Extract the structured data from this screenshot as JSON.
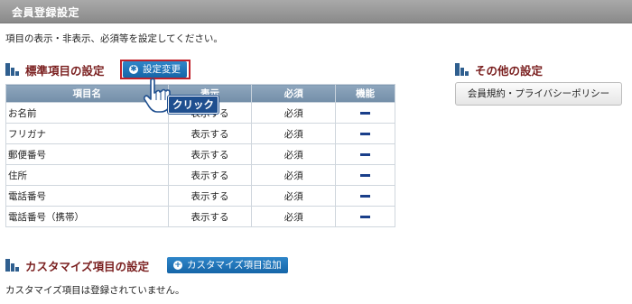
{
  "header": {
    "title": "会員登録設定"
  },
  "description": "項目の表示・非表示、必須等を設定してください。",
  "standard": {
    "title": "標準項目の設定",
    "settings_button": "設定変更",
    "columns": [
      "項目名",
      "表示",
      "必須",
      "機能"
    ],
    "rows": [
      {
        "name": "お名前",
        "display": "表示する",
        "required": "必須"
      },
      {
        "name": "フリガナ",
        "display": "表示する",
        "required": "必須"
      },
      {
        "name": "郵便番号",
        "display": "表示する",
        "required": "必須"
      },
      {
        "name": "住所",
        "display": "表示する",
        "required": "必須"
      },
      {
        "name": "電話番号",
        "display": "表示する",
        "required": "必須"
      },
      {
        "name": "電話番号（携帯）",
        "display": "表示する",
        "required": "必須"
      }
    ]
  },
  "annotation": {
    "click_label": "クリック"
  },
  "other": {
    "title": "その他の設定",
    "terms_button": "会員規約・プライバシーポリシー"
  },
  "custom": {
    "title": "カスタマイズ項目の設定",
    "add_button": "カスタマイズ項目追加",
    "empty_message": "カスタマイズ項目は登録されていません。"
  },
  "colors": {
    "accent": "#1565a8",
    "section_title": "#7a1f1f",
    "highlight": "#c0212a"
  }
}
